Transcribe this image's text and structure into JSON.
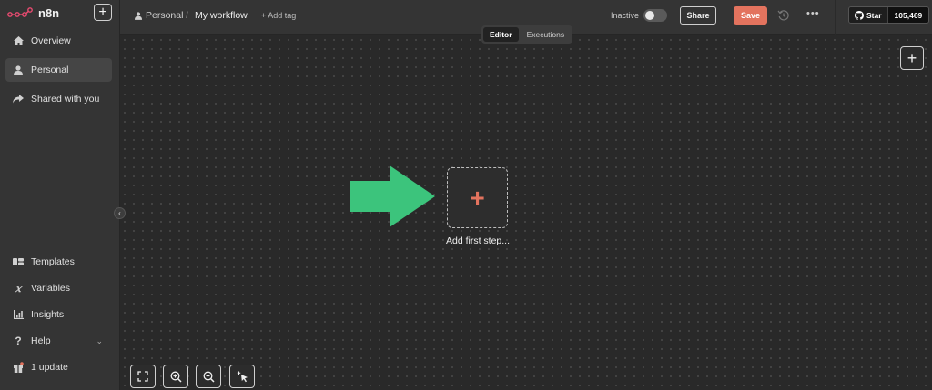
{
  "app": {
    "name": "n8n"
  },
  "sidebar": {
    "top_items": [
      {
        "label": "Overview",
        "icon": "home-icon"
      },
      {
        "label": "Personal",
        "icon": "user-icon"
      },
      {
        "label": "Shared with you",
        "icon": "share-icon"
      }
    ],
    "bottom_items": [
      {
        "label": "Templates",
        "icon": "templates-icon"
      },
      {
        "label": "Variables",
        "icon": "variables-icon"
      },
      {
        "label": "Insights",
        "icon": "chart-icon"
      },
      {
        "label": "Help",
        "icon": "help-icon"
      },
      {
        "label": "1 update",
        "icon": "gift-icon"
      }
    ]
  },
  "header": {
    "breadcrumb_project": "Personal",
    "breadcrumb_separator": "/",
    "workflow_name": "My workflow",
    "add_tag": "+ Add tag",
    "active_state_label": "Inactive",
    "share_label": "Share",
    "save_label": "Save",
    "github": {
      "star_label": "Star",
      "star_count": "105,469"
    }
  },
  "tabs": [
    {
      "label": "Editor",
      "active": true
    },
    {
      "label": "Executions",
      "active": false
    }
  ],
  "canvas": {
    "add_first_step_label": "Add first step...",
    "accent_color": "#e3735e",
    "arrow_color": "#3cc47c"
  },
  "colors": {
    "save": "#e3735e",
    "logo": "#ea4b71"
  }
}
